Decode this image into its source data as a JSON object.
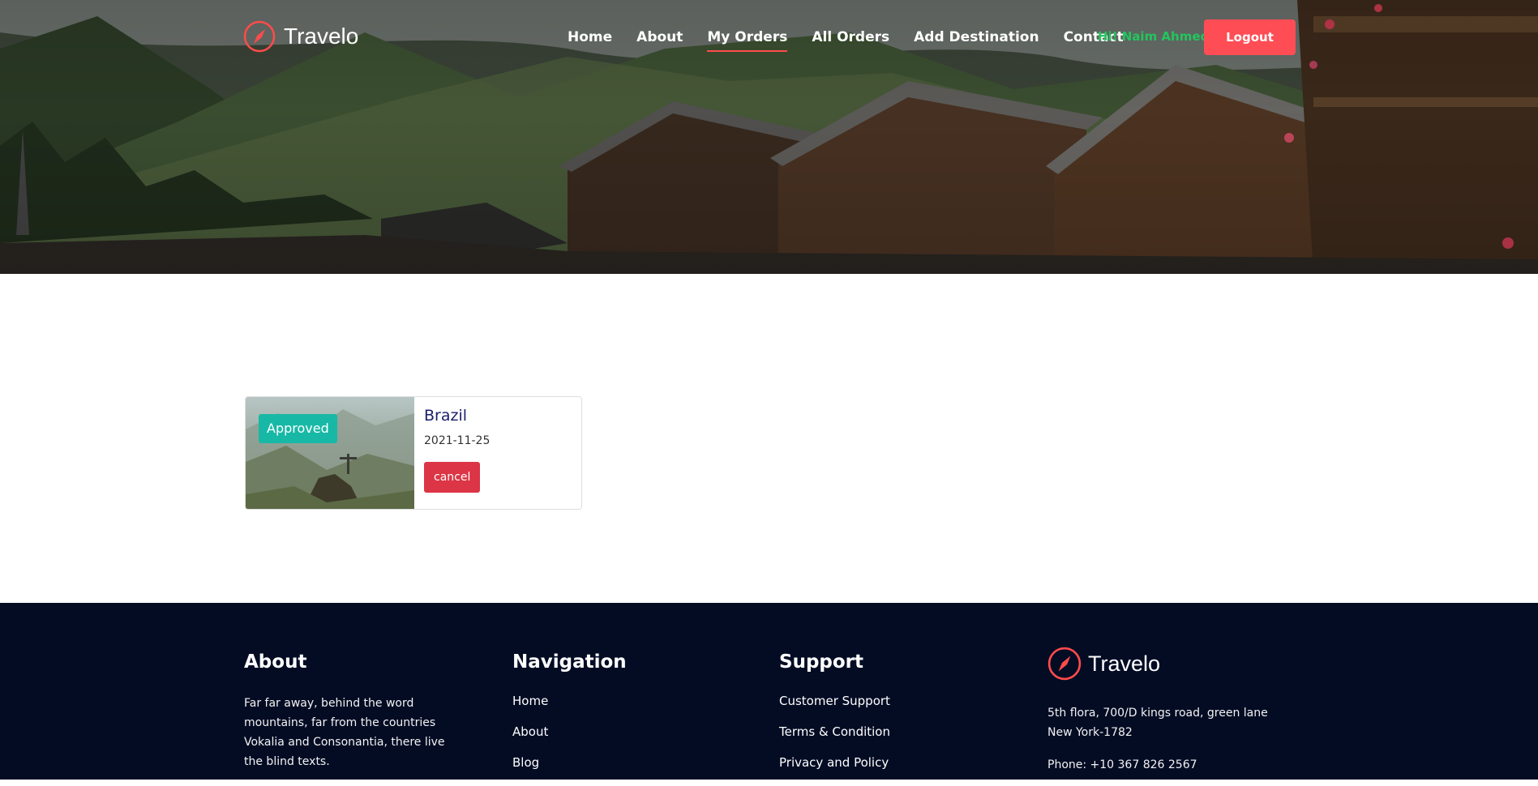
{
  "brand": {
    "name": "Travelo",
    "icon": "compass-icon",
    "accent": "#ff4b4b"
  },
  "nav": {
    "items": [
      "Home",
      "About",
      "My Orders",
      "All Orders",
      "Add Destination",
      "Contact"
    ],
    "active": "My Orders",
    "greeting": "Hi! Naim Ahmed",
    "logout_label": "Logout"
  },
  "orders": [
    {
      "title": "Brazil",
      "date": "2021-11-25",
      "status": "Approved",
      "cancel_label": "cancel"
    }
  ],
  "footer": {
    "about": {
      "heading": "About",
      "text": "Far far away, behind the word mountains, far from the countries Vokalia and Consonantia, there live the blind texts."
    },
    "navigation": {
      "heading": "Navigation",
      "links": [
        "Home",
        "About",
        "Blog"
      ]
    },
    "support": {
      "heading": "Support",
      "links": [
        "Customer Support",
        "Terms & Condition",
        "Privacy and Policy"
      ]
    },
    "contact": {
      "brand": "Travelo",
      "address_line1": "5th flora, 700/D kings road, green lane",
      "address_line2": "New York-1782",
      "phone": "Phone: +10 367 826 2567"
    }
  },
  "colors": {
    "badge": "#17b9a6",
    "cancel": "#dc3545",
    "logout": "#ff4d55",
    "greeting": "#22c55e",
    "footer_bg": "#040c24",
    "title": "#1b1f6b"
  }
}
